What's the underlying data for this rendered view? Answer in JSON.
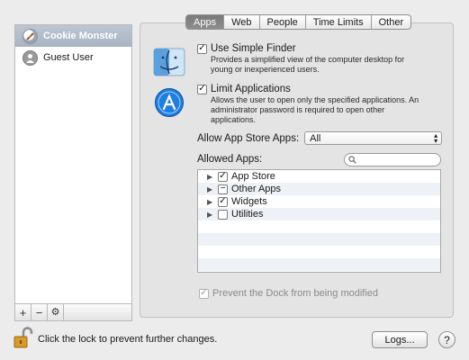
{
  "sidebar": {
    "users": [
      {
        "label": "Cookie Monster",
        "selected": true,
        "icon": "cookie-icon"
      },
      {
        "label": "Guest User",
        "selected": false,
        "icon": "guest-user-icon"
      }
    ],
    "toolbar": {
      "add": "+",
      "remove": "−",
      "gear": "⚙"
    }
  },
  "tabs": [
    {
      "label": "Apps",
      "active": true
    },
    {
      "label": "Web",
      "active": false
    },
    {
      "label": "People",
      "active": false
    },
    {
      "label": "Time Limits",
      "active": false
    },
    {
      "label": "Other",
      "active": false
    }
  ],
  "simple_finder": {
    "label": "Use Simple Finder",
    "checked": true,
    "desc1": "Provides a simplified view of the computer desktop for",
    "desc2": "young or inexperienced users."
  },
  "limit_apps": {
    "label": "Limit Applications",
    "checked": true,
    "desc1": "Allows the user to open only the specified applications. An",
    "desc2": "administrator password is required to open other",
    "desc3": "applications."
  },
  "app_store": {
    "label": "Allow App Store Apps:",
    "value": "All"
  },
  "allowed_apps": {
    "label": "Allowed Apps:",
    "search_placeholder": "",
    "items": [
      {
        "label": "App Store",
        "state": "checked"
      },
      {
        "label": "Other Apps",
        "state": "mixed"
      },
      {
        "label": "Widgets",
        "state": "checked"
      },
      {
        "label": "Utilities",
        "state": "unchecked"
      }
    ]
  },
  "prevent_dock": {
    "label": "Prevent the Dock from being modified",
    "checked": true,
    "enabled": false
  },
  "footer": {
    "lock_text": "Click the lock to prevent further changes.",
    "logs_button": "Logs...",
    "help_button": "?"
  },
  "colors": {
    "selection": "#a8b3c2",
    "active_tab": "#7f7f7f",
    "app_store_blue": "#1f7fe0"
  }
}
